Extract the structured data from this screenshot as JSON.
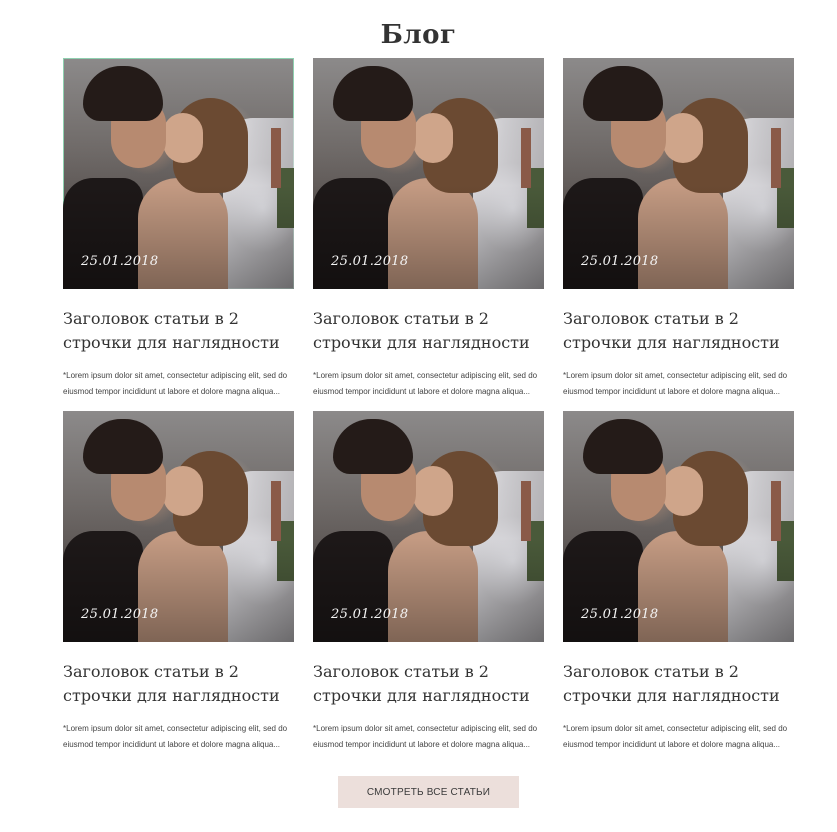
{
  "header": {
    "title": "Блог"
  },
  "posts": [
    {
      "date": "25.01.2018",
      "title": "Заголовок статьи в 2 строчки для наглядности",
      "excerpt": "*Lorem ipsum dolor sit amet, consectetur adipiscing elit, sed do eiusmod tempor incididunt ut labore et dolore magna aliqua..."
    },
    {
      "date": "25.01.2018",
      "title": "Заголовок статьи в 2 строчки для наглядности",
      "excerpt": "*Lorem ipsum dolor sit amet, consectetur adipiscing elit, sed do eiusmod tempor incididunt ut labore et dolore magna aliqua..."
    },
    {
      "date": "25.01.2018",
      "title": "Заголовок статьи в 2 строчки для наглядности",
      "excerpt": "*Lorem ipsum dolor sit amet, consectetur adipiscing elit, sed do eiusmod tempor incididunt ut labore et dolore magna aliqua..."
    },
    {
      "date": "25.01.2018",
      "title": "Заголовок статьи в 2 строчки для наглядности",
      "excerpt": "*Lorem ipsum dolor sit amet, consectetur adipiscing elit, sed do eiusmod tempor incididunt ut labore et dolore magna aliqua..."
    },
    {
      "date": "25.01.2018",
      "title": "Заголовок статьи в 2 строчки для наглядности",
      "excerpt": "*Lorem ipsum dolor sit amet, consectetur adipiscing elit, sed do eiusmod tempor incididunt ut labore et dolore magna aliqua..."
    },
    {
      "date": "25.01.2018",
      "title": "Заголовок статьи в 2 строчки для наглядности",
      "excerpt": "*Lorem ipsum dolor sit amet, consectetur adipiscing elit, sed do eiusmod tempor incididunt ut labore et dolore magna aliqua..."
    }
  ],
  "footer": {
    "all_posts_label": "СМОТРЕТЬ ВСЕ СТАТЬИ"
  },
  "colors": {
    "button_bg": "#ecdfdb",
    "focus_outline": "#8fd0b0"
  }
}
